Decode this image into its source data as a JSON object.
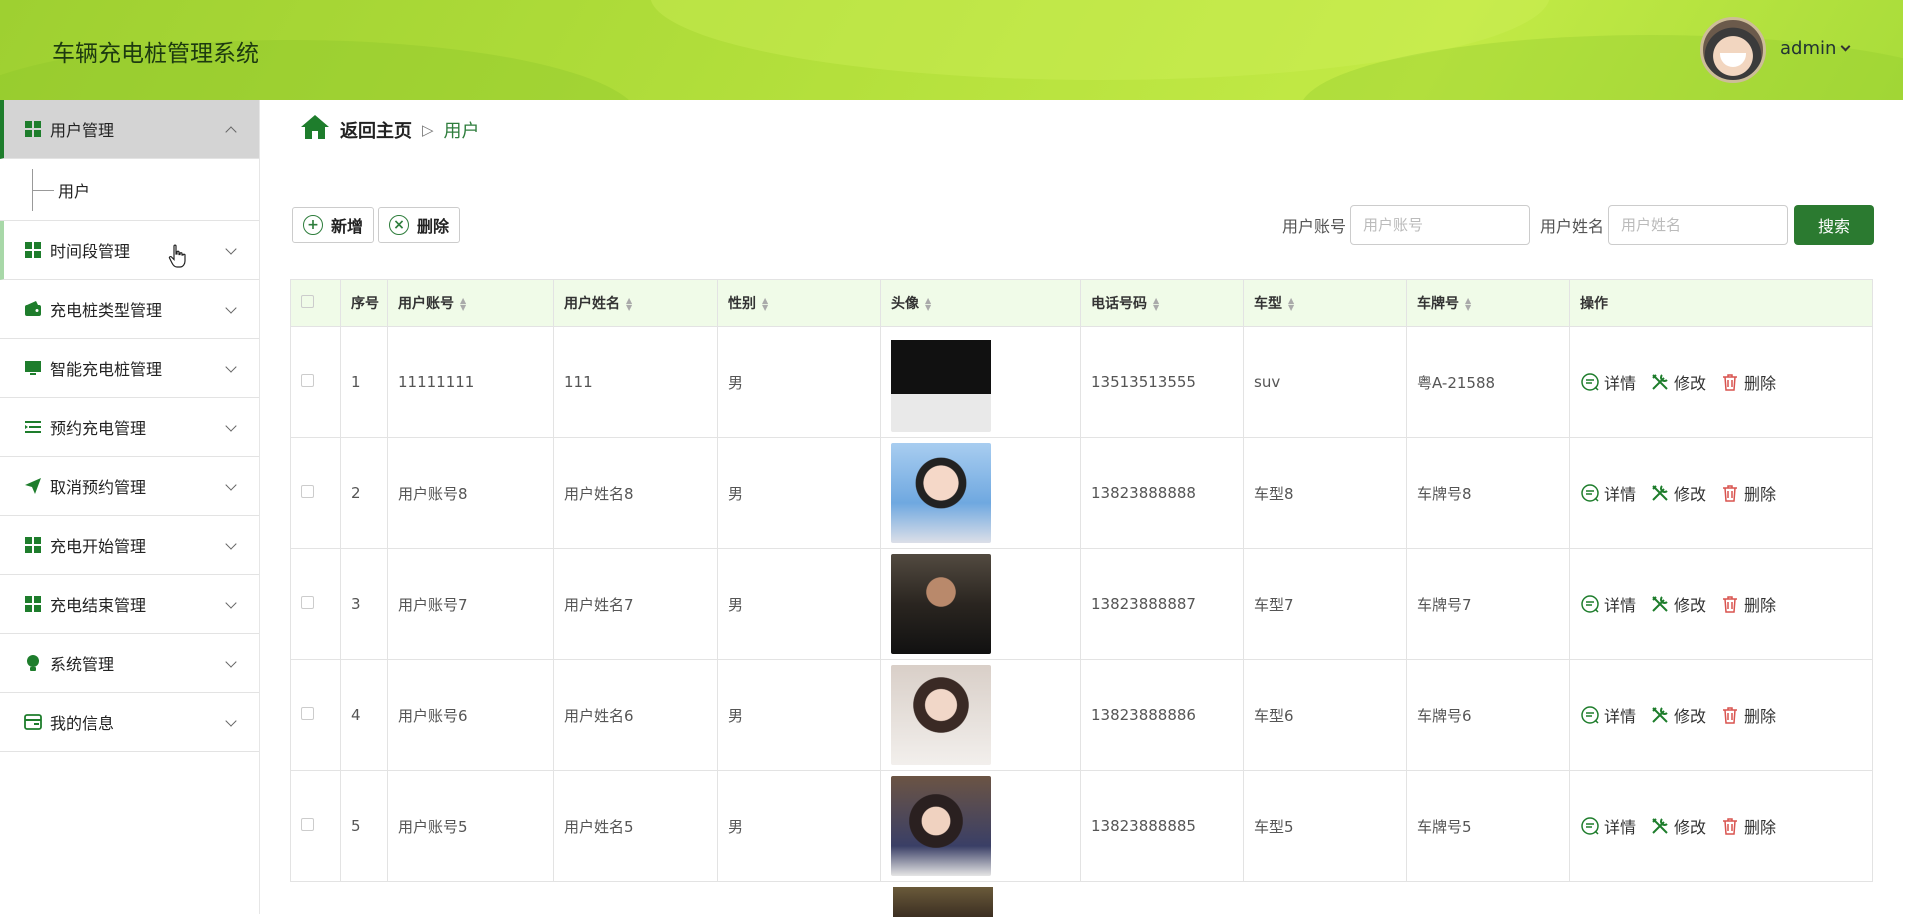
{
  "header": {
    "app_title": "车辆充电桩管理系统",
    "username": "admin"
  },
  "sidebar": {
    "items": [
      {
        "label": "用户管理",
        "icon": "grid-icon",
        "expanded": true,
        "sub": [
          "用户"
        ]
      },
      {
        "label": "时间段管理",
        "icon": "grid-icon"
      },
      {
        "label": "充电桩类型管理",
        "icon": "wallet-icon"
      },
      {
        "label": "智能充电桩管理",
        "icon": "monitor-icon"
      },
      {
        "label": "预约充电管理",
        "icon": "list-icon"
      },
      {
        "label": "取消预约管理",
        "icon": "send-icon"
      },
      {
        "label": "充电开始管理",
        "icon": "grid-icon"
      },
      {
        "label": "充电结束管理",
        "icon": "grid-icon"
      },
      {
        "label": "系统管理",
        "icon": "bulb-icon"
      },
      {
        "label": "我的信息",
        "icon": "card-icon"
      }
    ]
  },
  "breadcrumb": {
    "home": "返回主页",
    "separator": "▷",
    "current": "用户"
  },
  "toolbar": {
    "add_label": "新增",
    "delete_label": "删除"
  },
  "search": {
    "account_label": "用户账号",
    "account_placeholder": "用户账号",
    "name_label": "用户姓名",
    "name_placeholder": "用户姓名",
    "button_label": "搜索"
  },
  "table": {
    "headers": [
      "序号",
      "用户账号",
      "用户姓名",
      "性别",
      "头像",
      "电话号码",
      "车型",
      "车牌号",
      "操作"
    ],
    "rows": [
      {
        "index": "1",
        "account": "11111111",
        "name": "111",
        "gender": "男",
        "phone": "13513513555",
        "model": "suv",
        "plate": "粤A-21588"
      },
      {
        "index": "2",
        "account": "用户账号8",
        "name": "用户姓名8",
        "gender": "男",
        "phone": "13823888888",
        "model": "车型8",
        "plate": "车牌号8"
      },
      {
        "index": "3",
        "account": "用户账号7",
        "name": "用户姓名7",
        "gender": "男",
        "phone": "13823888887",
        "model": "车型7",
        "plate": "车牌号7"
      },
      {
        "index": "4",
        "account": "用户账号6",
        "name": "用户姓名6",
        "gender": "男",
        "phone": "13823888886",
        "model": "车型6",
        "plate": "车牌号6"
      },
      {
        "index": "5",
        "account": "用户账号5",
        "name": "用户姓名5",
        "gender": "男",
        "phone": "13823888885",
        "model": "车型5",
        "plate": "车牌号5"
      }
    ],
    "actions": {
      "detail": "详情",
      "edit": "修改",
      "delete": "删除"
    }
  },
  "colors": {
    "accent": "#2b7a30",
    "header_green": "#b4e03c",
    "table_header_bg": "#f0fbe8",
    "delete_red": "#d9534f"
  }
}
